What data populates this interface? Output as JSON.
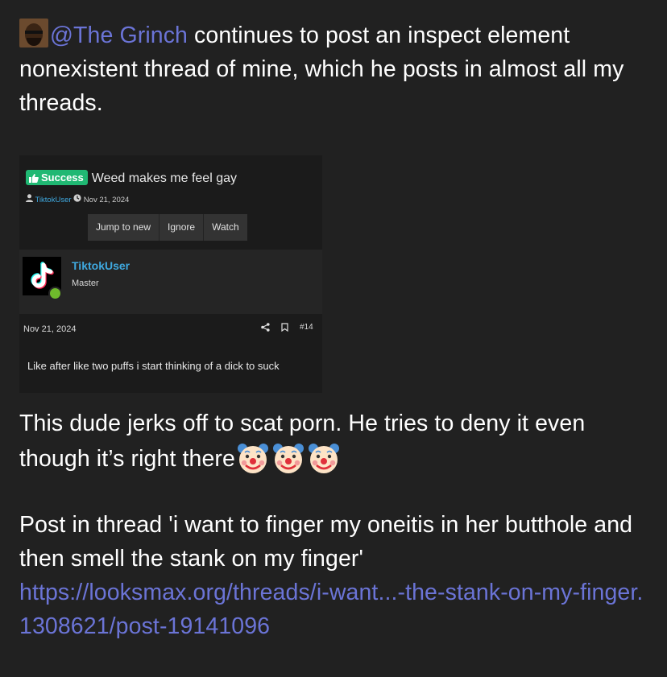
{
  "post": {
    "mention": "@The Grinch",
    "intro_rest": " continues to post an inspect element nonexistent thread of mine, which he posts in almost all my threads.",
    "paragraph2": "This dude jerks off to scat porn. He tries to deny it even though it’s right there",
    "clown_emoji_count": 3,
    "quote_line": "Post in thread 'i want to finger my oneitis in her butthole and then smell the stank on my finger'",
    "link": "https://looksmax.org/threads/i-want...-the-stank-on-my-finger.1308621/post-19141096"
  },
  "screenshot": {
    "badge": "Success",
    "thread_title": "Weed makes me feel gay",
    "author": "TiktokUser",
    "date": "Nov 21, 2024",
    "buttons": [
      "Jump to new",
      "Ignore",
      "Watch"
    ],
    "poster_name": "TiktokUser",
    "poster_rank": "Master",
    "post_date": "Nov 21, 2024",
    "post_number": "#14",
    "post_body": "Like after like two puffs i start thinking of a dick to suck"
  },
  "colors": {
    "background": "#212121",
    "link": "#6b74d6",
    "badge": "#20b873",
    "username": "#3fa9e0"
  }
}
